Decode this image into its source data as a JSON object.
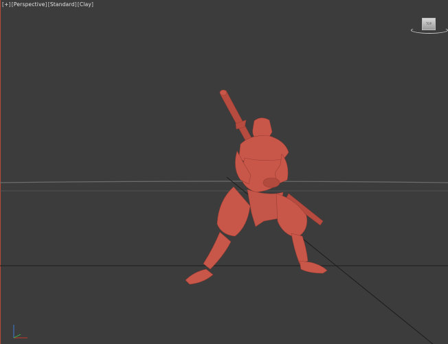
{
  "viewport": {
    "labels": {
      "menu": "+",
      "view": "Perspective",
      "shading": "Standard",
      "style": "Clay"
    },
    "viewcube_face": "TOP",
    "colors": {
      "background": "#3c3c3c",
      "clay": "#c8574a",
      "horizon": "#6a6a6a",
      "grid_line": "#1c1c1c"
    },
    "icons": [
      "viewcube-icon",
      "axis-tripod-icon"
    ]
  }
}
